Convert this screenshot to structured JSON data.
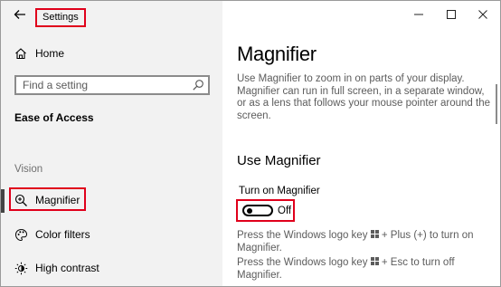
{
  "window": {
    "title": "Settings",
    "controls": {
      "minimize": "—",
      "maximize": "☐",
      "close": "✕"
    }
  },
  "sidebar": {
    "home_label": "Home",
    "search_placeholder": "Find a setting",
    "category": "Ease of Access",
    "section": "Vision",
    "items": [
      {
        "label": "Magnifier",
        "icon": "magnifier-icon",
        "selected": true
      },
      {
        "label": "Color filters",
        "icon": "color-filters-icon",
        "selected": false
      },
      {
        "label": "High contrast",
        "icon": "high-contrast-icon",
        "selected": false
      }
    ]
  },
  "main": {
    "title": "Magnifier",
    "description": "Use Magnifier to zoom in on parts of your display. Magnifier can run in full screen, in a separate window, or as a lens that follows your mouse pointer around the screen.",
    "section_title": "Use Magnifier",
    "toggle": {
      "label": "Turn on Magnifier",
      "state": "Off",
      "on": false
    },
    "hints": [
      {
        "before": "Press the Windows logo key",
        "after": "+ Plus (+) to turn on Magnifier."
      },
      {
        "before": "Press the Windows logo key",
        "after": "+ Esc to turn off Magnifier."
      }
    ]
  },
  "colors": {
    "highlight_border": "#e0001b",
    "sidebar_bg": "#f2f2f2",
    "accent_bar": "#444444"
  }
}
